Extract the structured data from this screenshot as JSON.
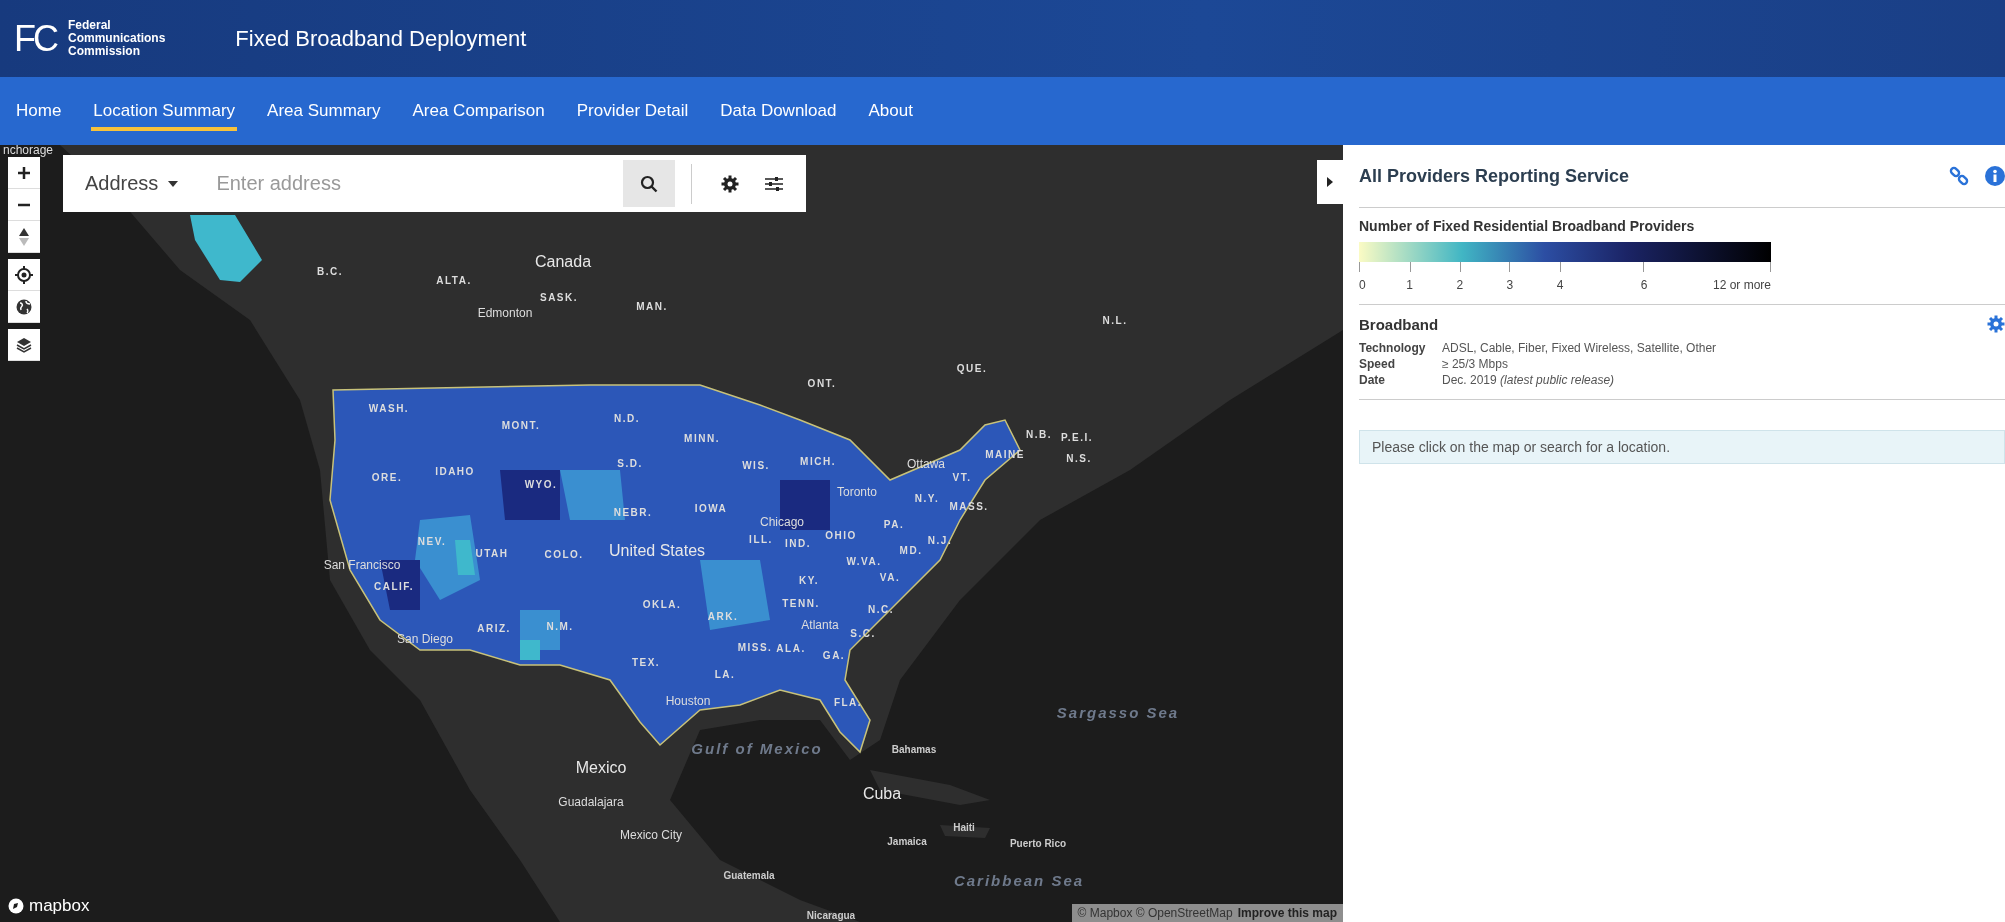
{
  "header": {
    "logo_mark": "FC",
    "agency": [
      "Federal",
      "Communications",
      "Commission"
    ],
    "title": "Fixed Broadband Deployment"
  },
  "nav": [
    {
      "label": "Home",
      "selected": false
    },
    {
      "label": "Location Summary",
      "selected": true
    },
    {
      "label": "Area Summary",
      "selected": false
    },
    {
      "label": "Area Comparison",
      "selected": false
    },
    {
      "label": "Provider Detail",
      "selected": false
    },
    {
      "label": "Data Download",
      "selected": false
    },
    {
      "label": "About",
      "selected": false
    }
  ],
  "search": {
    "mode": "Address",
    "placeholder": "Enter address"
  },
  "map": {
    "labels": [
      {
        "text": "nchorage",
        "kind": "city"
      },
      {
        "text": "Canada",
        "kind": "country"
      },
      {
        "text": "B.C.",
        "kind": "region"
      },
      {
        "text": "ALTA.",
        "kind": "region"
      },
      {
        "text": "SASK.",
        "kind": "region"
      },
      {
        "text": "MAN.",
        "kind": "region"
      },
      {
        "text": "Edmonton",
        "kind": "city"
      },
      {
        "text": "ONT.",
        "kind": "region"
      },
      {
        "text": "QUE.",
        "kind": "region"
      },
      {
        "text": "N.L.",
        "kind": "region"
      },
      {
        "text": "N.B.",
        "kind": "region"
      },
      {
        "text": "P.E.I.",
        "kind": "region"
      },
      {
        "text": "N.S.",
        "kind": "region"
      },
      {
        "text": "Ottawa",
        "kind": "city"
      },
      {
        "text": "Toronto",
        "kind": "city"
      },
      {
        "text": "WASH.",
        "kind": "region"
      },
      {
        "text": "MONT.",
        "kind": "region"
      },
      {
        "text": "N.D.",
        "kind": "region"
      },
      {
        "text": "MINN.",
        "kind": "region"
      },
      {
        "text": "S.D.",
        "kind": "region"
      },
      {
        "text": "WIS.",
        "kind": "region"
      },
      {
        "text": "MICH.",
        "kind": "region"
      },
      {
        "text": "IDAHO",
        "kind": "region"
      },
      {
        "text": "ORE.",
        "kind": "region"
      },
      {
        "text": "WYO.",
        "kind": "region"
      },
      {
        "text": "NEBR.",
        "kind": "region"
      },
      {
        "text": "IOWA",
        "kind": "region"
      },
      {
        "text": "MAINE",
        "kind": "region"
      },
      {
        "text": "VT.",
        "kind": "region"
      },
      {
        "text": "N.Y.",
        "kind": "region"
      },
      {
        "text": "MASS.",
        "kind": "region"
      },
      {
        "text": "Chicago",
        "kind": "city"
      },
      {
        "text": "PA.",
        "kind": "region"
      },
      {
        "text": "NEV.",
        "kind": "region"
      },
      {
        "text": "UTAH",
        "kind": "region"
      },
      {
        "text": "COLO.",
        "kind": "region"
      },
      {
        "text": "United States",
        "kind": "country"
      },
      {
        "text": "ILL.",
        "kind": "region"
      },
      {
        "text": "IND.",
        "kind": "region"
      },
      {
        "text": "OHIO",
        "kind": "region"
      },
      {
        "text": "MD.",
        "kind": "region"
      },
      {
        "text": "N.J.",
        "kind": "region"
      },
      {
        "text": "W.VA.",
        "kind": "region"
      },
      {
        "text": "VA.",
        "kind": "region"
      },
      {
        "text": "San Francisco",
        "kind": "city"
      },
      {
        "text": "CALIF.",
        "kind": "region"
      },
      {
        "text": "KY.",
        "kind": "region"
      },
      {
        "text": "OKLA.",
        "kind": "region"
      },
      {
        "text": "TENN.",
        "kind": "region"
      },
      {
        "text": "ARK.",
        "kind": "region"
      },
      {
        "text": "N.C.",
        "kind": "region"
      },
      {
        "text": "ARIZ.",
        "kind": "region"
      },
      {
        "text": "N.M.",
        "kind": "region"
      },
      {
        "text": "Atlanta",
        "kind": "city"
      },
      {
        "text": "S.C.",
        "kind": "region"
      },
      {
        "text": "San Diego",
        "kind": "city"
      },
      {
        "text": "MISS.",
        "kind": "region"
      },
      {
        "text": "ALA.",
        "kind": "region"
      },
      {
        "text": "GA.",
        "kind": "region"
      },
      {
        "text": "TEX.",
        "kind": "region"
      },
      {
        "text": "LA.",
        "kind": "region"
      },
      {
        "text": "Houston",
        "kind": "city"
      },
      {
        "text": "FLA.",
        "kind": "region"
      },
      {
        "text": "Sargasso Sea",
        "kind": "water"
      },
      {
        "text": "Gulf of Mexico",
        "kind": "water"
      },
      {
        "text": "Bahamas",
        "kind": "place"
      },
      {
        "text": "Mexico",
        "kind": "country"
      },
      {
        "text": "Cuba",
        "kind": "country"
      },
      {
        "text": "Guadalajara",
        "kind": "city"
      },
      {
        "text": "Mexico City",
        "kind": "city"
      },
      {
        "text": "Haiti",
        "kind": "place"
      },
      {
        "text": "Jamaica",
        "kind": "place"
      },
      {
        "text": "Puerto Rico",
        "kind": "place"
      },
      {
        "text": "Guatemala",
        "kind": "place"
      },
      {
        "text": "Caribbean Sea",
        "kind": "water"
      },
      {
        "text": "Nicaragua",
        "kind": "place"
      }
    ],
    "brand": "mapbox",
    "attribution": "© Mapbox © OpenStreetMap",
    "improve_link": "Improve this map"
  },
  "panel": {
    "title": "All Providers Reporting Service",
    "legend": {
      "title": "Number of Fixed Residential Broadband Providers",
      "ticks": [
        "0",
        "1",
        "2",
        "3",
        "4",
        "6",
        "12 or more"
      ]
    },
    "broadband": {
      "title": "Broadband",
      "rows": [
        {
          "label": "Technology",
          "value": "ADSL, Cable, Fiber, Fixed Wireless, Satellite, Other"
        },
        {
          "label": "Speed",
          "value": "≥ 25/3 Mbps"
        },
        {
          "label": "Date",
          "value": "Dec. 2019 *(latest public release)*"
        }
      ]
    },
    "notice": "Please click on the map or search for a location."
  }
}
